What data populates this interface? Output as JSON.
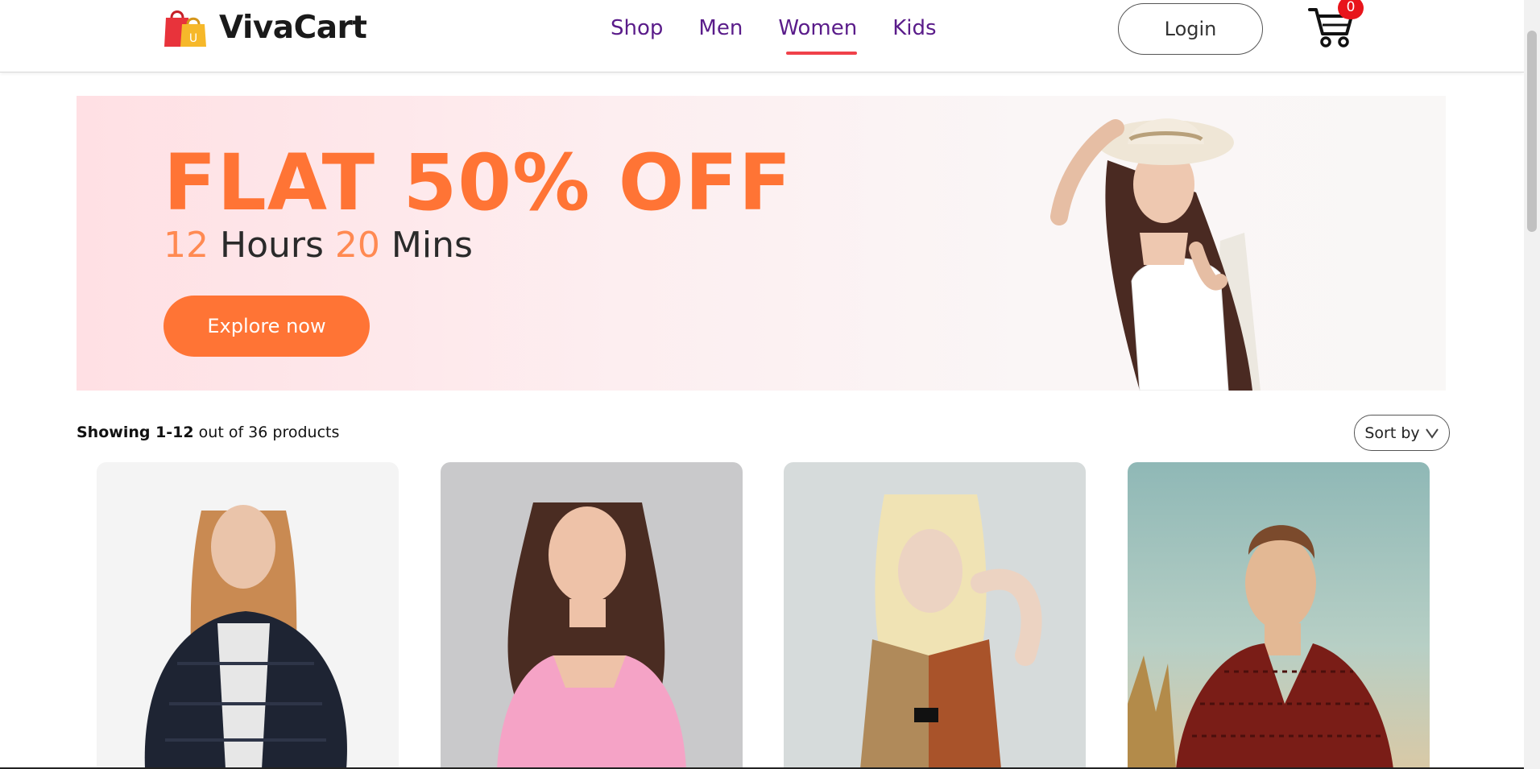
{
  "brand": {
    "name": "VivaCart",
    "logo_letter": "U"
  },
  "nav": {
    "items": [
      {
        "label": "Shop"
      },
      {
        "label": "Men"
      },
      {
        "label": "Women",
        "active": true
      },
      {
        "label": "Kids"
      }
    ]
  },
  "header": {
    "login_label": "Login",
    "cart_count": "0",
    "cart_icon": "cart-icon"
  },
  "banner": {
    "title": "FLAT 50% OFF",
    "hours_value": "12",
    "hours_unit": "Hours",
    "mins_value": "20",
    "mins_unit": "Mins",
    "cta_label": "Explore now"
  },
  "listing": {
    "showing_bold": "Showing 1-12",
    "showing_rest": "out of 36 products",
    "sort_label": "Sort by",
    "sort_icon": "chevron-down-icon"
  },
  "colors": {
    "accent": "#ff7435",
    "nav_text": "#5a1c8a",
    "active_underline": "#f0414a",
    "badge": "#e8151b"
  }
}
